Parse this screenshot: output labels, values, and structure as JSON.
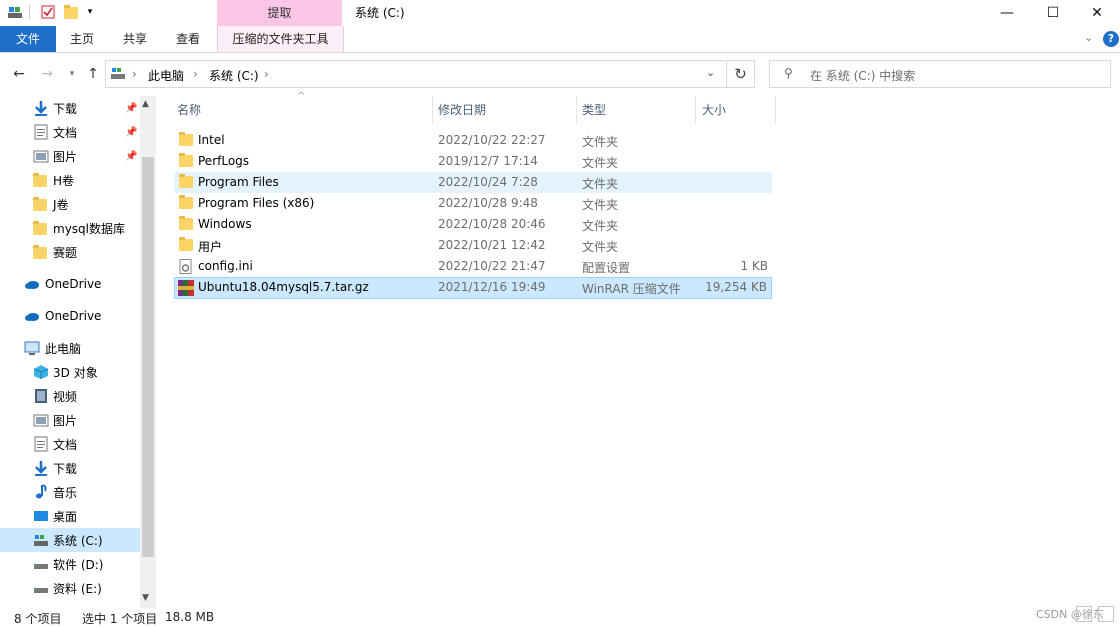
{
  "window": {
    "title": "系统 (C:)",
    "context_group": "提取",
    "controls": {
      "minimize": "—",
      "maximize": "☐",
      "close": "✕"
    }
  },
  "ribbon": {
    "tabs": [
      "文件",
      "主页",
      "共享",
      "查看",
      "压缩的文件夹工具"
    ],
    "help": "?"
  },
  "address": {
    "segments": [
      "此电脑",
      "系统 (C:)"
    ],
    "search_placeholder": "在 系统 (C:) 中搜索"
  },
  "nav_pane": {
    "quick_access": [
      {
        "label": "下载",
        "icon": "download-icon",
        "pinned": true
      },
      {
        "label": "文档",
        "icon": "document-icon",
        "pinned": true
      },
      {
        "label": "图片",
        "icon": "picture-icon",
        "pinned": true
      },
      {
        "label": "H卷",
        "icon": "folder-icon"
      },
      {
        "label": "J卷",
        "icon": "folder-icon"
      },
      {
        "label": "mysql数据库",
        "icon": "folder-icon"
      },
      {
        "label": "赛题",
        "icon": "folder-icon"
      }
    ],
    "onedrive": [
      "OneDrive",
      "OneDrive"
    ],
    "this_pc": "此电脑",
    "pc_items": [
      {
        "label": "3D 对象",
        "icon": "3d-objects-icon"
      },
      {
        "label": "视频",
        "icon": "video-icon"
      },
      {
        "label": "图片",
        "icon": "picture-icon"
      },
      {
        "label": "文档",
        "icon": "document-icon"
      },
      {
        "label": "下载",
        "icon": "download-icon"
      },
      {
        "label": "音乐",
        "icon": "music-icon"
      },
      {
        "label": "桌面",
        "icon": "desktop-icon"
      },
      {
        "label": "系统 (C:)",
        "icon": "drive-icon",
        "selected": true
      },
      {
        "label": "软件 (D:)",
        "icon": "drive-icon"
      },
      {
        "label": "资料 (E:)",
        "icon": "drive-icon"
      }
    ]
  },
  "file_list": {
    "columns": [
      "名称",
      "修改日期",
      "类型",
      "大小"
    ],
    "rows": [
      {
        "name": "Intel",
        "date": "2022/10/22 22:27",
        "type": "文件夹",
        "size": "",
        "kind": "folder"
      },
      {
        "name": "PerfLogs",
        "date": "2019/12/7 17:14",
        "type": "文件夹",
        "size": "",
        "kind": "folder"
      },
      {
        "name": "Program Files",
        "date": "2022/10/24 7:28",
        "type": "文件夹",
        "size": "",
        "kind": "folder",
        "hover": true
      },
      {
        "name": "Program Files (x86)",
        "date": "2022/10/28 9:48",
        "type": "文件夹",
        "size": "",
        "kind": "folder"
      },
      {
        "name": "Windows",
        "date": "2022/10/28 20:46",
        "type": "文件夹",
        "size": "",
        "kind": "folder"
      },
      {
        "name": "用户",
        "date": "2022/10/21 12:42",
        "type": "文件夹",
        "size": "",
        "kind": "folder"
      },
      {
        "name": "config.ini",
        "date": "2022/10/22 21:47",
        "type": "配置设置",
        "size": "1 KB",
        "kind": "ini"
      },
      {
        "name": "Ubuntu18.04mysql5.7.tar.gz",
        "date": "2021/12/16 19:49",
        "type": "WinRAR 压缩文件",
        "size": "19,254 KB",
        "kind": "rar",
        "selected": true
      }
    ]
  },
  "status_bar": {
    "item_count": "8 个项目",
    "selection": "选中 1 个项目",
    "selection_size": "18.8 MB",
    "watermark": "CSDN @徐东"
  },
  "colors": {
    "file_tab": "#1e6fc7",
    "context_tab": "#f9c6e6",
    "selected_row": "#cce8ff",
    "hover_row": "#e5f3ff"
  }
}
